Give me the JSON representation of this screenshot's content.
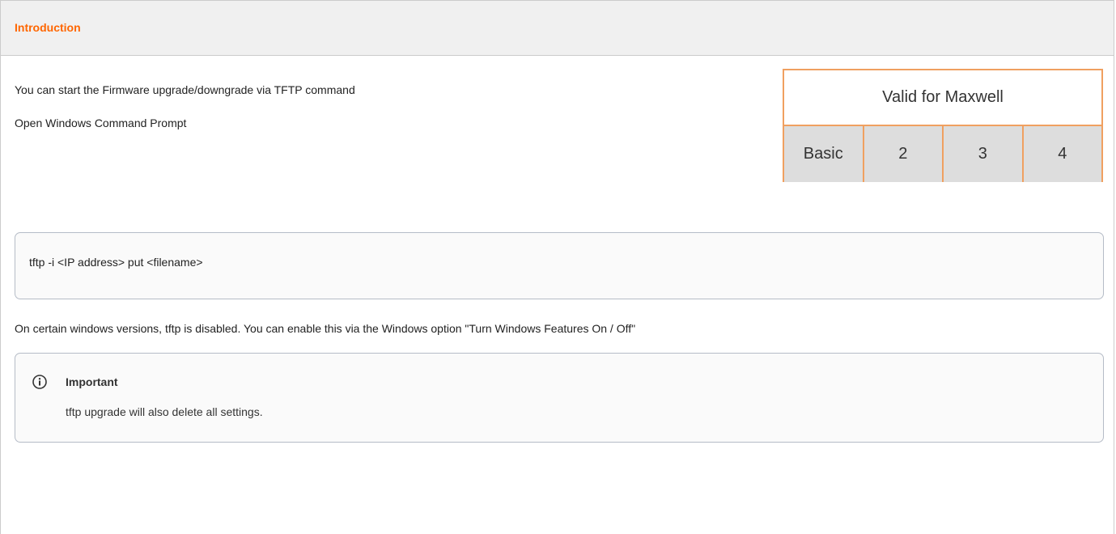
{
  "panel": {
    "title": "Introduction"
  },
  "intro": {
    "line1": "You can start the Firmware upgrade/downgrade via TFTP command",
    "line2": "Open Windows Command Prompt"
  },
  "valid_badge": {
    "heading": "Valid for Maxwell",
    "models": [
      "Basic",
      "2",
      "3",
      "4"
    ]
  },
  "code": {
    "command": "tftp -i <IP address> put <filename>"
  },
  "note": {
    "text": "On certain windows versions, tftp is disabled. You can enable this via the Windows option \"Turn Windows Features On / Off\""
  },
  "info": {
    "icon": "info-icon",
    "title": "Important",
    "body": "tftp upgrade will also delete all settings."
  },
  "colors": {
    "accent": "#ff6600",
    "badge_border": "#f0a060",
    "badge_fill": "#dddddd",
    "box_border": "#b5bcc7"
  }
}
